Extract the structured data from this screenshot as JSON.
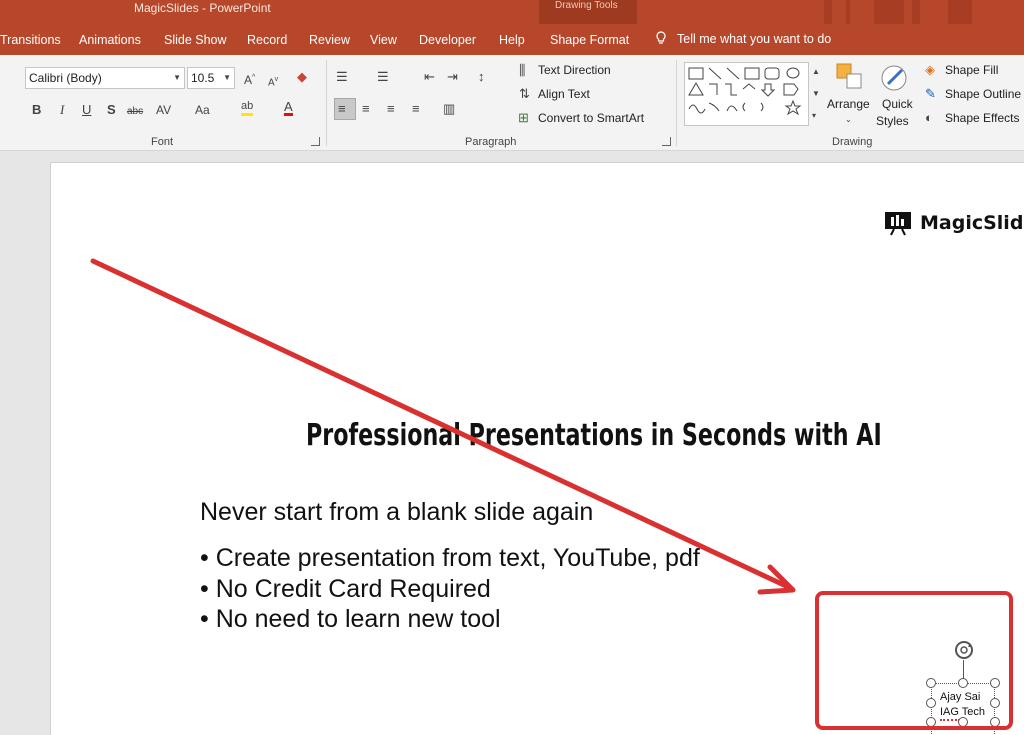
{
  "app": {
    "title": "MagicSlides  -  PowerPoint",
    "context_group": "Drawing Tools"
  },
  "tabs": [
    {
      "label": "Transitions"
    },
    {
      "label": "Animations"
    },
    {
      "label": "Slide Show"
    },
    {
      "label": "Record"
    },
    {
      "label": "Review"
    },
    {
      "label": "View"
    },
    {
      "label": "Developer"
    },
    {
      "label": "Help"
    },
    {
      "label": "Shape Format",
      "active": true
    }
  ],
  "tell_me": "Tell me what you want to do",
  "ribbon": {
    "font": {
      "font_name": "Calibri (Body)",
      "font_size": "10.5",
      "label": "Font",
      "buttons": [
        "B",
        "I",
        "U",
        "S",
        "abc",
        "AV",
        "Aa",
        "A"
      ]
    },
    "paragraph": {
      "label": "Paragraph",
      "text_direction": "Text Direction",
      "align_text": "Align Text",
      "convert_smartart": "Convert to SmartArt"
    },
    "drawing": {
      "label": "Drawing",
      "arrange": "Arrange",
      "quick_styles_1": "Quick",
      "quick_styles_2": "Styles",
      "shape_fill": "Shape Fill",
      "shape_outline": "Shape Outline",
      "shape_effects": "Shape Effects"
    }
  },
  "slide": {
    "brand": "MagicSlides",
    "title": "Professional Presentations in Seconds with AI",
    "tagline": "Never start from a blank slide again",
    "bullets": [
      "• Create presentation from text, YouTube, pdf",
      "• No Credit Card Required",
      "• No need to learn new tool"
    ],
    "selected_textbox": {
      "line1": "Ajay Sai",
      "line2": "IAG Tech"
    }
  },
  "colors": {
    "accent": "#b7472a",
    "annotation": "#d93131"
  }
}
